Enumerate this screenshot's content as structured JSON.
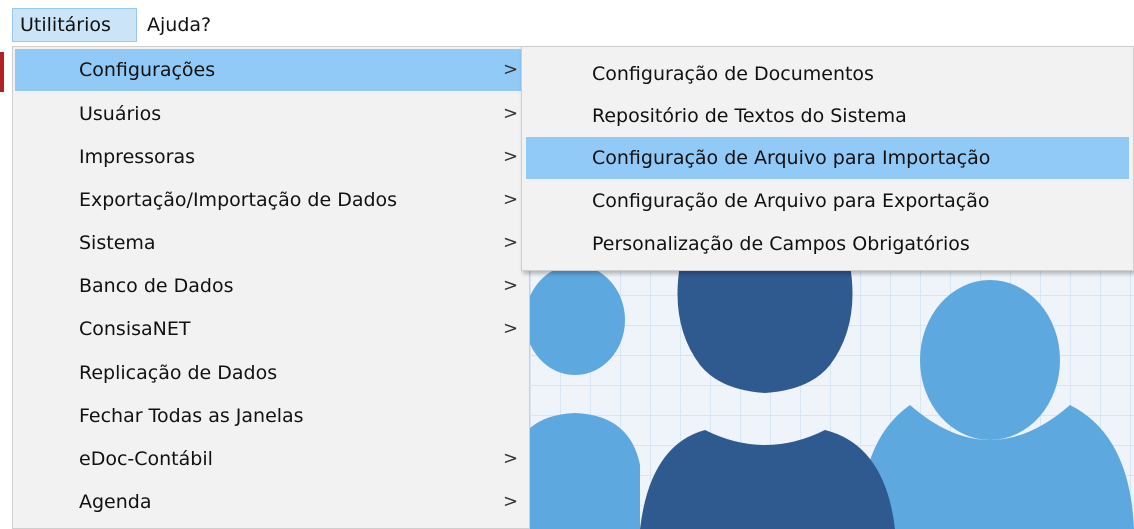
{
  "menubar": {
    "items": [
      {
        "label": "Utilitários"
      },
      {
        "label": "Ajuda?"
      }
    ]
  },
  "menu": {
    "items": [
      {
        "label": "Configurações",
        "chevron": ">"
      },
      {
        "label": "Usuários",
        "chevron": ">"
      },
      {
        "label": "Impressoras",
        "chevron": ">"
      },
      {
        "label": "Exportação/Importação de Dados",
        "chevron": ">"
      },
      {
        "label": "Sistema",
        "chevron": ">"
      },
      {
        "label": "Banco de Dados",
        "chevron": ">"
      },
      {
        "label": "ConsisaNET",
        "chevron": ">"
      },
      {
        "label": "Replicação de Dados"
      },
      {
        "label": "Fechar Todas as Janelas"
      },
      {
        "label": "eDoc-Contábil",
        "chevron": ">"
      },
      {
        "label": "Agenda",
        "chevron": ">"
      }
    ]
  },
  "submenu": {
    "items": [
      {
        "label": "Configuração de Documentos"
      },
      {
        "label": "Repositório de Textos do Sistema"
      },
      {
        "label": "Configuração de Arquivo para Importação"
      },
      {
        "label": "Configuração de Arquivo para Exportação"
      },
      {
        "label": "Personalização de Campos Obrigatórios"
      }
    ]
  },
  "colors": {
    "highlight": "#91c9f7",
    "menu_bg": "#f2f2f2",
    "people_dark": "#2f5a8f",
    "people_light": "#5ea8e0"
  }
}
